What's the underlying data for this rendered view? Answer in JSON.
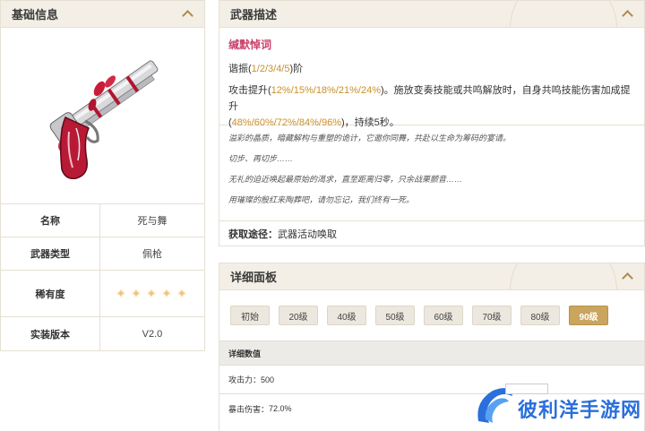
{
  "basic": {
    "title": "基础信息",
    "weapon_image": "red-silver-revolver-illustration",
    "rows": [
      {
        "key": "名称",
        "value": "死与舞"
      },
      {
        "key": "武器类型",
        "value": "佩枪"
      },
      {
        "key": "稀有度",
        "stars": 5
      },
      {
        "key": "实装版本",
        "value": "V2.0"
      }
    ]
  },
  "desc": {
    "title": "武器描述",
    "skill_name": "缄默悼词",
    "resonance_prefix": "谐振(",
    "resonance_levels": "1/2/3/4/5",
    "resonance_suffix": ")阶",
    "effect_a": "攻击提升(",
    "effect_a_values": "12%/15%/18%/21%/24%",
    "effect_b": ")。施放变奏技能或共鸣解放时，自身共鸣技能伤害加成提升",
    "effect_c": "(",
    "effect_c_values": "48%/60%/72%/84%/96%",
    "effect_d": ")，持续5秒。",
    "lore": [
      "溢彩的晶质，暗藏解构与重塑的诡计，它邀你同舞，共赴以生命为筹码的宴请。",
      "切步、再切步……",
      "无礼的迫近唤起最原始的渴求，直至距离归零，只余战栗颤音……",
      "用璀璨的殷红来陶葬吧，请勿忘记，我们终有一死。"
    ],
    "obtain_label": "获取途径：",
    "obtain_value": "武器活动唤取"
  },
  "detail": {
    "title": "详细面板",
    "levels": [
      "初始",
      "20级",
      "40级",
      "50级",
      "60级",
      "70级",
      "80级",
      "90级"
    ],
    "active_level": "90级",
    "sub_title": "详细数值",
    "stats": [
      {
        "label": "攻击力：",
        "value": "500"
      },
      {
        "label": "暴击伤害：",
        "value": "72.0%"
      }
    ]
  },
  "watermark": {
    "text": "彼利洋手游网",
    "logo": "blue-swoosh-logo"
  },
  "colors": {
    "accent": "#c9a55e",
    "skill_name": "#c8416b",
    "highlight": "#c9902a",
    "header_bg": "#f3efe6",
    "star": "#f2c47a"
  }
}
